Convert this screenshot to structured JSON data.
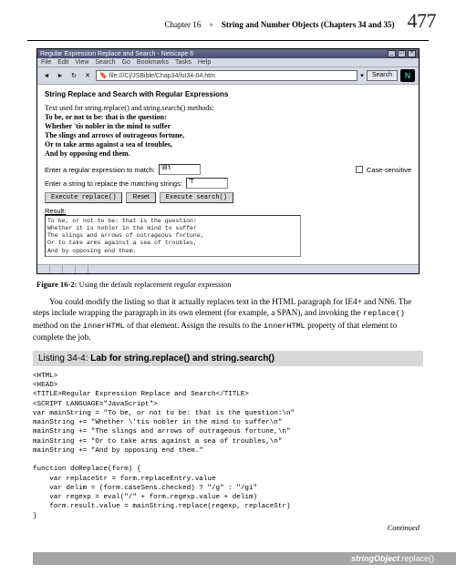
{
  "header": {
    "chapter_ref": "Chapter 16",
    "separator": "✦",
    "chapter_title": "String and Number Objects (Chapters 34 and 35)",
    "page_number": "477"
  },
  "browser": {
    "window_title": "Regular Expression Replace and Search - Netscape 6",
    "controls": {
      "min": "_",
      "max": "□",
      "close": "×"
    },
    "menu": [
      "File",
      "Edit",
      "View",
      "Search",
      "Go",
      "Bookmarks",
      "Tasks",
      "Help"
    ],
    "url": "file:///C|/JSBible/Chap34/lst34-04.htm",
    "url_dropdown": "▾",
    "search_label": "Search",
    "n_logo": "N",
    "page_heading": "String Replace and Search with Regular Expressions",
    "poem_intro": "Text used for string.replace() and string.search() methods:",
    "poem_lines": [
      "To be, or not to be: that is the question:",
      "Whether 'tis nobler in the mind to suffer",
      "The slings and arrows of outrageous fortune,",
      "Or to take arms against a sea of troubles,",
      "And by opposing end them."
    ],
    "regex_label": "Enter a regular expression to match:",
    "regex_value": "\\B't",
    "case_label": "Case-sensitive",
    "replace_label": "Enter a string to replace the matching strings:",
    "replace_value": "'T",
    "buttons": {
      "exec_replace": "Execute replace()",
      "reset": "Reset",
      "exec_search": "Execute search()"
    },
    "result_label": "Result:",
    "result_text": "To be, or not to be: that is the question:\nWhether it is nobler in the mind to suffer\nThe slings and arrows of outrageous fortune,\nOr to take arms against a sea of troubles,\nAnd by opposing end them."
  },
  "figure": {
    "label": "Figure 16-2:",
    "caption": "Using the default replacement regular expression"
  },
  "body_text": "You could modify the listing so that it actually replaces text in the HTML paragraph for IE4+ and NN6. The steps include wrapping the paragraph in its own element (for example, a SPAN), and invoking the replace() method on the innerHTML of that element. Assign the results to the innerHTML property of that element to complete the job.",
  "listing": {
    "label": "Listing 34-4:",
    "title": "Lab for string.replace() and string.search()"
  },
  "code": "<HTML>\n<HEAD>\n<TITLE>Regular Expression Replace and Search</TITLE>\n<SCRIPT LANGUAGE=\"JavaScript\">\nvar mainString = \"To be, or not to be: that is the question:\\n\"\nmainString += \"Whether \\'tis nobler in the mind to suffer\\n\"\nmainString += \"The slings and arrows of outrageous fortune,\\n\"\nmainString += \"Or to take arms against a sea of troubles,\\n\"\nmainString += \"And by opposing end them.\"\n\nfunction doReplace(form) {\n    var replaceStr = form.replaceEntry.value\n    var delim = (form.caseSens.checked) ? \"/g\" : \"/gi\"\n    var regexp = eval(\"/\" + form.regexp.value + delim)\n    form.result.value = mainString.replace(regexp, replaceStr)\n}",
  "continued": "Continued",
  "footer": {
    "object": "stringObject",
    "method": ".replace()"
  }
}
